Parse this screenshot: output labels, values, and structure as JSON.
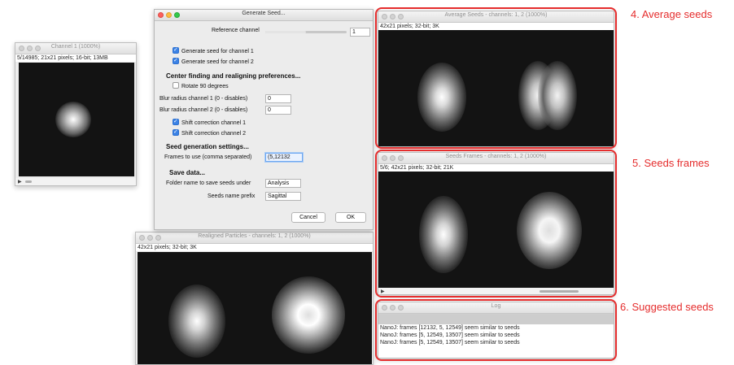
{
  "channel1_window": {
    "title": "Channel 1 (1000%)",
    "info": "5/14985; 21x21 pixels; 16-bit; 13MB"
  },
  "dialog": {
    "title": "Generate Seed...",
    "reference_channel_label": "Reference channel",
    "reference_channel_value": "1",
    "generate_seed_ch1": "Generate seed for channel 1",
    "generate_seed_ch2": "Generate seed for channel 2",
    "center_heading": "Center finding and realigning preferences...",
    "rotate_label": "Rotate 90 degrees",
    "blur1_label": "Blur radius channel 1 (0 - disables)",
    "blur1_value": "0",
    "blur2_label": "Blur radius channel 2 (0 - disables)",
    "blur2_value": "0",
    "shift1_label": "Shift correction channel 1",
    "shift2_label": "Shift correction channel 2",
    "seed_heading": "Seed generation settings...",
    "frames_label": "Frames to use (comma separated)",
    "frames_value": "(5,12132",
    "save_heading": "Save data...",
    "folder_label": "Folder name to save seeds under",
    "folder_value": "Analysis",
    "prefix_label": "Seeds name prefix",
    "prefix_value": "Sagittal",
    "cancel_label": "Cancel",
    "ok_label": "OK",
    "checkbox_states": {
      "ch1": true,
      "ch2": true,
      "rotate": false,
      "shift1": true,
      "shift2": true
    }
  },
  "realigned_window": {
    "title": "Realigned Particles - channels: 1, 2 (1000%)",
    "info": "42x21 pixels; 32-bit; 3K"
  },
  "average_window": {
    "title": "Average Seeds - channels: 1, 2 (1000%)",
    "info": "42x21 pixels; 32-bit; 3K"
  },
  "frames_window": {
    "title": "Seeds Frames - channels: 1, 2 (1000%)",
    "info": "5/6; 42x21 pixels; 32-bit; 21K"
  },
  "log_window": {
    "title": "Log",
    "lines": [
      "NanoJ: frames [12132, 5, 12549] seem similar to seeds",
      "NanoJ: frames [5, 12549, 13507] seem similar to seeds",
      "NanoJ: frames [5, 12549, 13507] seem similar to seeds"
    ]
  },
  "annotations": {
    "average": "4. Average seeds",
    "frames": "5. Seeds frames",
    "suggested": "6. Suggested seeds"
  },
  "colors": {
    "annotation": "#e52d2d",
    "checkbox_on": "#3b82e5"
  }
}
